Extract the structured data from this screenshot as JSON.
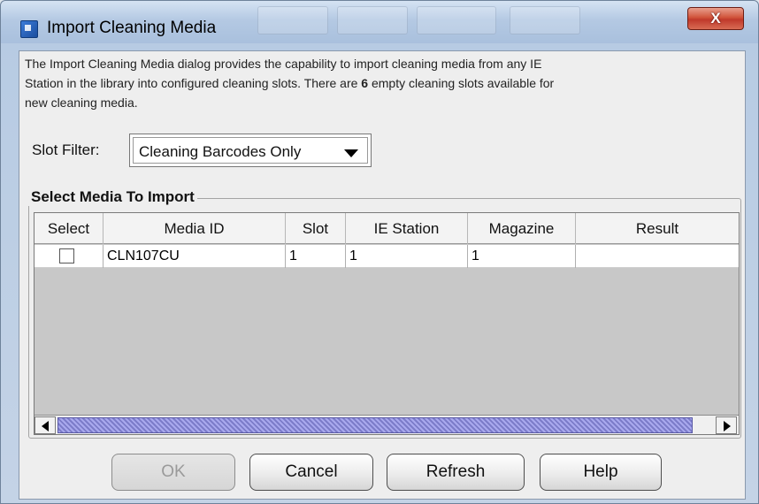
{
  "window": {
    "title": "Import Cleaning Media",
    "close_label": "X"
  },
  "description": {
    "line1": "The Import Cleaning Media dialog provides the capability to import cleaning media from any IE",
    "line2_prefix": "Station in the library into configured cleaning slots. There are ",
    "empty_slots_count": "6",
    "line2_suffix": " empty cleaning slots available for",
    "line3": "new cleaning media."
  },
  "slot_filter": {
    "label": "Slot Filter:",
    "selected": "Cleaning Barcodes Only"
  },
  "media_group": {
    "title": "Select Media To Import",
    "columns": [
      "Select",
      "Media ID",
      "Slot",
      "IE Station",
      "Magazine",
      "Result"
    ],
    "rows": [
      {
        "selected": false,
        "media_id": "CLN107CU",
        "slot": "1",
        "ie_station": "1",
        "magazine": "1",
        "result": ""
      }
    ]
  },
  "buttons": {
    "ok": "OK",
    "cancel": "Cancel",
    "refresh": "Refresh",
    "help": "Help"
  }
}
